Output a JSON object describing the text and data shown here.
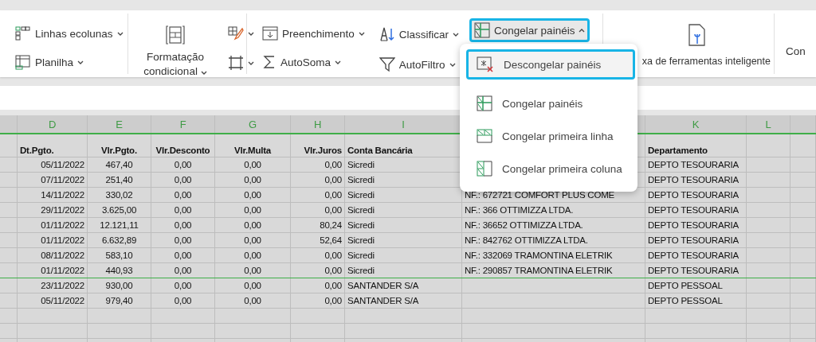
{
  "ribbon": {
    "cells_group": [
      {
        "label": "Linhas ecolunas"
      },
      {
        "label": "Planilha"
      }
    ],
    "format_button": {
      "label": "Formatação condicional"
    },
    "editing_group": [
      {
        "label": "Preenchimento"
      },
      {
        "label": "AutoSoma"
      },
      {
        "label": "Classificar"
      },
      {
        "label": "AutoFiltro"
      }
    ],
    "freeze_button": {
      "label": "Congelar painéis",
      "expanded": true
    },
    "tools_button": {
      "label": "xa de ferramentas inteligente"
    },
    "next_button": {
      "label": "Con"
    }
  },
  "freeze_menu": [
    {
      "label": "Descongelar painéis",
      "highlighted": true
    },
    {
      "label": "Congelar painéis",
      "highlighted": false
    },
    {
      "label": "Congelar primeira linha",
      "highlighted": false
    },
    {
      "label": "Congelar primeira coluna",
      "highlighted": false
    }
  ],
  "column_headers": {
    "d": "D",
    "e": "E",
    "f": "F",
    "g": "G",
    "h": "H",
    "i": "I",
    "k": "K",
    "l": "L"
  },
  "table_header": {
    "d": "Dt.Pgto.",
    "e": "Vlr.Pgto.",
    "f": "Vlr.Desconto",
    "g": "Vlr.Multa",
    "h": "Vlr.Juros",
    "i": "Conta Bancária",
    "k": "Departamento"
  },
  "rows": [
    {
      "d": "05/11/2022",
      "e": "467,40",
      "f": "0,00",
      "g": "0,00",
      "h": "0,00",
      "i": "Sicredi",
      "k": "DEPTO TESOURARIA",
      "freeze_line_below": false
    },
    {
      "d": "07/11/2022",
      "e": "251,40",
      "f": "0,00",
      "g": "0,00",
      "h": "0,00",
      "i": "Sicredi",
      "k": "DEPTO TESOURARIA",
      "freeze_line_below": false
    },
    {
      "d": "14/11/2022",
      "e": "330,02",
      "f": "0,00",
      "g": "0,00",
      "h": "0,00",
      "i": "Sicredi",
      "j": "NF.: 672721 COMFORT PLUS COME",
      "k": "DEPTO TESOURARIA",
      "freeze_line_below": false
    },
    {
      "d": "29/11/2022",
      "e": "3.625,00",
      "f": "0,00",
      "g": "0,00",
      "h": "0,00",
      "i": "Sicredi",
      "j": "NF.: 366 OTTIMIZZA LTDA.",
      "k": "DEPTO TESOURARIA",
      "freeze_line_below": false
    },
    {
      "d": "01/11/2022",
      "e": "12.121,11",
      "f": "0,00",
      "g": "0,00",
      "h": "80,24",
      "i": "Sicredi",
      "j": "NF.: 36652 OTTIMIZZA LTDA.",
      "k": "DEPTO TESOURARIA",
      "freeze_line_below": false
    },
    {
      "d": "01/11/2022",
      "e": "6.632,89",
      "f": "0,00",
      "g": "0,00",
      "h": "52,64",
      "i": "Sicredi",
      "j": "NF.: 842762 OTTIMIZZA LTDA.",
      "k": "DEPTO TESOURARIA",
      "freeze_line_below": false
    },
    {
      "d": "08/11/2022",
      "e": "583,10",
      "f": "0,00",
      "g": "0,00",
      "h": "0,00",
      "i": "Sicredi",
      "j": "NF.: 332069 TRAMONTINA ELETRIK",
      "k": "DEPTO TESOURARIA",
      "freeze_line_below": false
    },
    {
      "d": "01/11/2022",
      "e": "440,93",
      "f": "0,00",
      "g": "0,00",
      "h": "0,00",
      "i": "Sicredi",
      "j": "NF.: 290857 TRAMONTINA ELETRIK",
      "k": "DEPTO TESOURARIA",
      "freeze_line_below": true
    },
    {
      "d": "23/11/2022",
      "e": "930,00",
      "f": "0,00",
      "g": "0,00",
      "h": "0,00",
      "i": "SANTANDER S/A",
      "k": "DEPTO PESSOAL",
      "freeze_line_below": false
    },
    {
      "d": "05/11/2022",
      "e": "979,40",
      "f": "0,00",
      "g": "0,00",
      "h": "0,00",
      "i": "SANTANDER S/A",
      "k": "DEPTO PESSOAL",
      "freeze_line_below": false
    }
  ]
}
